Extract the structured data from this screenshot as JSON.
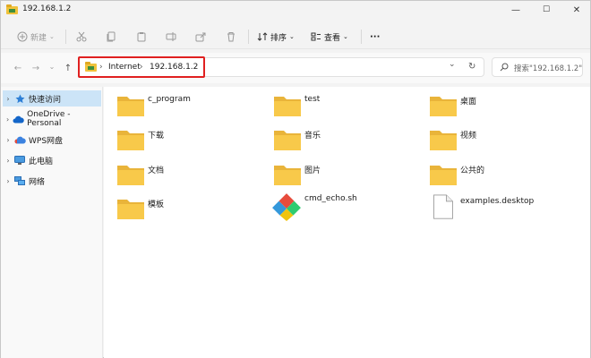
{
  "window": {
    "title": "192.168.1.2"
  },
  "window_controls": {
    "minimize": "—",
    "maximize": "☐",
    "close": "✕"
  },
  "toolbar": {
    "new_label": "新建",
    "sort_label": "排序",
    "view_label": "查看",
    "more_label": "···"
  },
  "nav": {
    "back": "←",
    "forward": "→",
    "dropdown": "⌄",
    "up": "↑",
    "breadcrumb": [
      "Internet",
      "192.168.1.2"
    ],
    "breadcrumb_sep": "›",
    "refresh": "↻",
    "addr_dropdown": "⌄"
  },
  "search": {
    "placeholder": "搜索\"192.168.1.2\""
  },
  "sidebar": {
    "items": [
      {
        "label": "快速访问",
        "icon": "star-icon",
        "selected": true
      },
      {
        "label": "OneDrive - Personal",
        "icon": "cloud-icon",
        "selected": false
      },
      {
        "label": "WPS网盘",
        "icon": "wps-cloud-icon",
        "selected": false
      },
      {
        "label": "此电脑",
        "icon": "computer-icon",
        "selected": false
      },
      {
        "label": "网络",
        "icon": "network-icon",
        "selected": false
      }
    ]
  },
  "files": [
    {
      "name": "c_program",
      "type": "folder"
    },
    {
      "name": "test",
      "type": "folder"
    },
    {
      "name": "桌面",
      "type": "folder"
    },
    {
      "name": "下载",
      "type": "folder"
    },
    {
      "name": "音乐",
      "type": "folder"
    },
    {
      "name": "视频",
      "type": "folder"
    },
    {
      "name": "文档",
      "type": "folder"
    },
    {
      "name": "图片",
      "type": "folder"
    },
    {
      "name": "公共的",
      "type": "folder"
    },
    {
      "name": "模板",
      "type": "folder"
    },
    {
      "name": "cmd_echo.sh",
      "type": "script"
    },
    {
      "name": "examples.desktop",
      "type": "file"
    }
  ],
  "colors": {
    "accent": "#0067c0",
    "folder": "#f8c94a",
    "highlight": "#e02020",
    "selection": "#cce4f7"
  }
}
